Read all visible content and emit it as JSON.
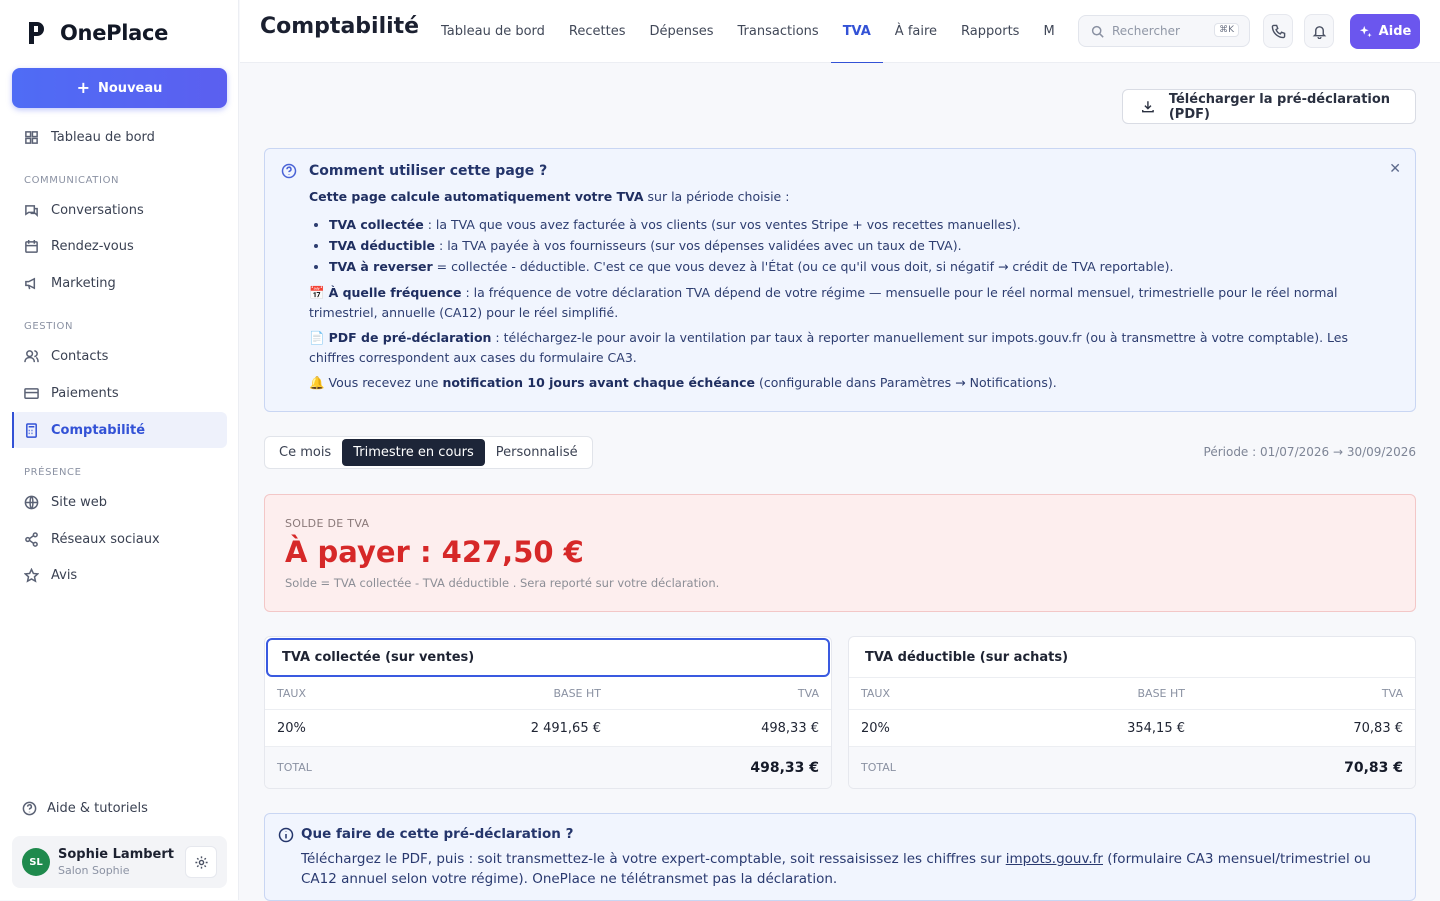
{
  "app": {
    "name": "OnePlace"
  },
  "sidebar": {
    "new_button": "Nouveau",
    "dashboard": "Tableau de bord",
    "sections": {
      "communication": "COMMUNICATION",
      "gestion": "GESTION",
      "presence": "PRÉSENCE"
    },
    "items": {
      "conversations": "Conversations",
      "rendezvous": "Rendez-vous",
      "marketing": "Marketing",
      "contacts": "Contacts",
      "paiements": "Paiements",
      "comptabilite": "Comptabilité",
      "siteweb": "Site web",
      "reseaux": "Réseaux sociaux",
      "avis": "Avis"
    },
    "help": "Aide & tutoriels",
    "user": {
      "initials": "SL",
      "name": "Sophie Lambert",
      "business": "Salon Sophie"
    }
  },
  "header": {
    "title": "Comptabilité",
    "tabs": [
      "Tableau de bord",
      "Recettes",
      "Dépenses",
      "Transactions",
      "TVA",
      "À faire",
      "Rapports",
      "Mon co"
    ],
    "active_tab": "TVA",
    "search_placeholder": "Rechercher",
    "search_shortcut": "⌘K",
    "aide_button": "Aide"
  },
  "actions": {
    "download_pdf": "Télécharger la pré-déclaration (PDF)"
  },
  "info": {
    "title": "Comment utiliser cette page ?",
    "intro_bold": "Cette page calcule automatiquement votre TVA",
    "intro_rest": " sur la période choisie :",
    "bullets": [
      {
        "bold": "TVA collectée",
        "text": " : la TVA que vous avez facturée à vos clients (sur vos ventes Stripe + vos recettes manuelles)."
      },
      {
        "bold": "TVA déductible",
        "text": " : la TVA payée à vos fournisseurs (sur vos dépenses validées avec un taux de TVA)."
      },
      {
        "bold": "TVA à reverser",
        "text": " = collectée - déductible. C'est ce que vous devez à l'État (ou ce qu'il vous doit, si négatif → crédit de TVA reportable)."
      }
    ],
    "freq_emoji": "📅",
    "freq_bold": "À quelle fréquence",
    "freq_text": " : la fréquence de votre déclaration TVA dépend de votre régime — mensuelle pour le réel normal mensuel, trimestrielle pour le réel normal trimestriel, annuelle (CA12) pour le réel simplifié.",
    "pdf_emoji": "📄",
    "pdf_bold": "PDF de pré-déclaration",
    "pdf_text": " : téléchargez-le pour avoir la ventilation par taux à reporter manuellement sur impots.gouv.fr (ou à transmettre à votre comptable). Les chiffres correspondent aux cases du formulaire CA3.",
    "notif_emoji": "🔔",
    "notif_pre": " Vous recevez une ",
    "notif_bold": "notification 10 jours avant chaque échéance",
    "notif_post": " (configurable dans Paramètres → Notifications)."
  },
  "period_selector": {
    "options": [
      "Ce mois",
      "Trimestre en cours",
      "Personnalisé"
    ],
    "active": "Trimestre en cours",
    "range_text": "Période : 01/07/2026 → 30/09/2026"
  },
  "balance": {
    "label": "SOLDE DE TVA",
    "value": "À payer : 427,50 €",
    "note": "Solde = TVA collectée - TVA déductible . Sera reporté sur votre déclaration.",
    "color": "#d62828"
  },
  "collected": {
    "title": "TVA collectée (sur ventes)",
    "headers": [
      "TAUX",
      "BASE HT",
      "TVA"
    ],
    "rows": [
      {
        "rate": "20%",
        "base": "2 491,65 €",
        "tva": "498,33 €"
      }
    ],
    "total_label": "TOTAL",
    "total": "498,33 €"
  },
  "deductible": {
    "title": "TVA déductible (sur achats)",
    "headers": [
      "TAUX",
      "BASE HT",
      "TVA"
    ],
    "rows": [
      {
        "rate": "20%",
        "base": "354,15 €",
        "tva": "70,83 €"
      }
    ],
    "total_label": "TOTAL",
    "total": "70,83 €"
  },
  "bottom_info": {
    "title": "Que faire de cette pré-déclaration ?",
    "text_pre": "Téléchargez le PDF, puis : soit transmettez-le à votre expert-comptable, soit ressaisissez les chiffres sur ",
    "link": "impots.gouv.fr",
    "text_post": " (formulaire CA3 mensuel/trimestriel ou CA12 annuel selon votre régime). OnePlace ne télétransmet pas la déclaration."
  },
  "colors": {
    "accent": "#3352d6",
    "aide": "#6b56ee",
    "danger": "#d62828"
  }
}
